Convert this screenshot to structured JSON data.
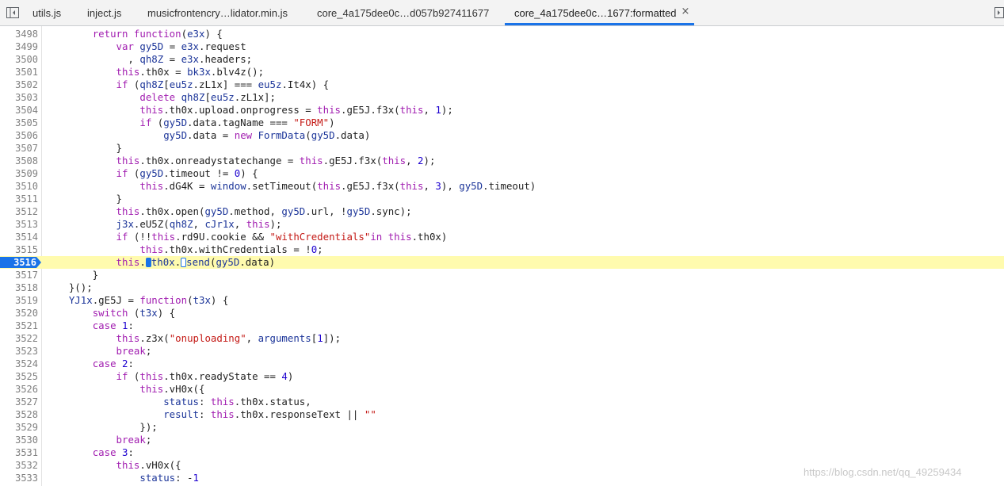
{
  "tabs": [
    {
      "label": "utils.js",
      "active": false
    },
    {
      "label": "inject.js",
      "active": false
    },
    {
      "label": "musicfrontencry…lidator.min.js",
      "active": false
    },
    {
      "label": "core_4a175dee0c…d057b927411677",
      "active": false
    },
    {
      "label": "core_4a175dee0c…1677:formatted",
      "active": true
    }
  ],
  "tab_close_glyph": "×",
  "breakpoint_line": "3516",
  "line_numbers": [
    "3498",
    "3499",
    "3500",
    "3501",
    "3502",
    "3503",
    "3504",
    "3505",
    "3506",
    "3507",
    "3508",
    "3509",
    "3510",
    "3511",
    "3512",
    "3513",
    "3514",
    "3515",
    "3516",
    "3517",
    "3518",
    "3519",
    "3520",
    "3521",
    "3522",
    "3523",
    "3524",
    "3525",
    "3526",
    "3527",
    "3528",
    "3529",
    "3530",
    "3531",
    "3532",
    "3533"
  ],
  "code_lines": [
    "        return function(e3x) {",
    "            var gy5D = e3x.request",
    "              , qh8Z = e3x.headers;",
    "            this.th0x = bk3x.blv4z();",
    "            if (qh8Z[eu5z.zL1x] === eu5z.It4x) {",
    "                delete qh8Z[eu5z.zL1x];",
    "                this.th0x.upload.onprogress = this.gE5J.f3x(this, 1);",
    "                if (gy5D.data.tagName === \"FORM\")",
    "                    gy5D.data = new FormData(gy5D.data)",
    "            }",
    "            this.th0x.onreadystatechange = this.gE5J.f3x(this, 2);",
    "            if (gy5D.timeout != 0) {",
    "                this.dG4K = window.setTimeout(this.gE5J.f3x(this, 3), gy5D.timeout)",
    "            }",
    "            this.th0x.open(gy5D.method, gy5D.url, !gy5D.sync);",
    "            j3x.eU5Z(qh8Z, cJr1x, this);",
    "            if (!!this.rd9U.cookie && \"withCredentials\"in this.th0x)",
    "                this.th0x.withCredentials = !0;",
    "            this.◌th0x.◌send(gy5D.data)",
    "        }",
    "    }();",
    "    YJ1x.gE5J = function(t3x) {",
    "        switch (t3x) {",
    "        case 1:",
    "            this.z3x(\"onuploading\", arguments[1]);",
    "            break;",
    "        case 2:",
    "            if (this.th0x.readyState == 4)",
    "                this.vH0x({",
    "                    status: this.th0x.status,",
    "                    result: this.th0x.responseText || \"\"",
    "                });",
    "            break;",
    "        case 3:",
    "            this.vH0x({",
    "                status: -1"
  ],
  "watermark": "https://blog.csdn.net/qq_49259434",
  "colors": {
    "keyword": "#a11db0",
    "variable": "#1c3599",
    "string": "#c41a16",
    "number": "#1c00cf",
    "highlight": "#fffbae",
    "breakpoint": "#1a73e8"
  }
}
